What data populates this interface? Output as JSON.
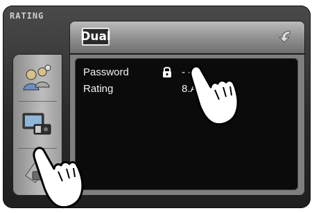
{
  "window": {
    "title": "RATING"
  },
  "header": {
    "logo_text": "Dual",
    "back_icon": "back-arrow-icon"
  },
  "sidebar": {
    "items": [
      {
        "name": "users",
        "icon": "users-icon"
      },
      {
        "name": "video",
        "icon": "video-icon"
      },
      {
        "name": "rating",
        "icon": "rating-icon"
      }
    ]
  },
  "settings": {
    "password_label": "Password",
    "password_value": "- - - -",
    "rating_label": "Rating",
    "rating_value": "8.Ad"
  }
}
